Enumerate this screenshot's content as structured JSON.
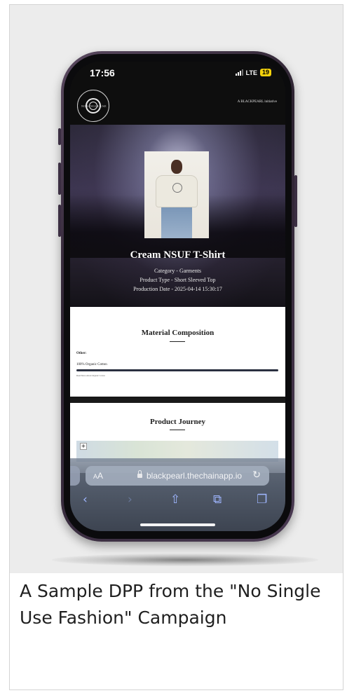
{
  "status_bar": {
    "time": "17:56",
    "network": "LTE",
    "battery": "19"
  },
  "site": {
    "logo_text": "NO SINGLE USE FASHION",
    "tagline": "A BLACKPEARL initiative"
  },
  "product": {
    "title": "Cream NSUF T-Shirt",
    "category": "Category - Garments",
    "type": "Product Type - Short Sleeved Top",
    "production_date": "Production Date - 2025-04-14 15:30:17"
  },
  "material": {
    "heading": "Material Composition",
    "group_label": "Other:",
    "item": "100% Organic Cotton",
    "share_percent": 100,
    "link": "Read More About Organic Cotton"
  },
  "journey": {
    "heading": "Product Journey",
    "zoom_in": "+"
  },
  "browser": {
    "aa_label_small": "A",
    "aa_label": "A",
    "url": "blackpearl.thechainapp.io"
  },
  "icons": {
    "back": "chevron-left-icon",
    "forward": "chevron-right-icon",
    "share": "share-icon",
    "bookmarks": "book-icon",
    "tabs": "tabs-icon",
    "reload": "reload-icon",
    "lock": "lock-icon"
  },
  "colors": {
    "accent": "#9fb6ff",
    "battery": "#f5d20c",
    "bar_fill": "#2a3040"
  },
  "caption": "A Sample DPP from the \"No Single Use Fashion\" Campaign"
}
